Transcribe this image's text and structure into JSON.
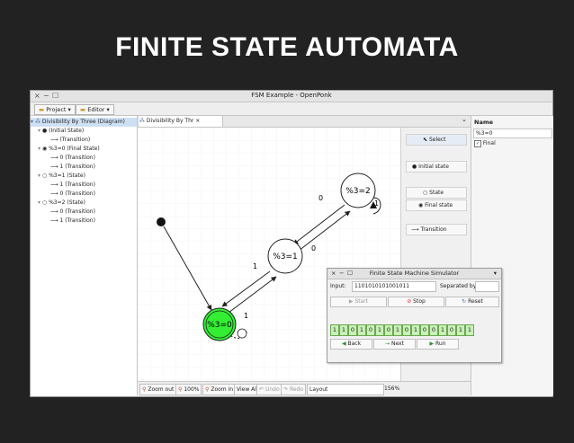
{
  "heading": "FINITE STATE AUTOMATA",
  "window": {
    "title": "FSM Example - OpenPonk",
    "controls": [
      "×",
      "−",
      "☐"
    ]
  },
  "menubar": {
    "project": "Project ▾",
    "editor": "Editor ▾"
  },
  "tree": {
    "items": [
      {
        "label": "Divisibility By Three (Diagram)"
      },
      {
        "label": "(Initial State)"
      },
      {
        "label": "(Transition)"
      },
      {
        "label": "%3=0 (Final State)"
      },
      {
        "label": "0 (Transition)"
      },
      {
        "label": "1 (Transition)"
      },
      {
        "label": "%3=1 (State)"
      },
      {
        "label": "1 (Transition)"
      },
      {
        "label": "0 (Transition)"
      },
      {
        "label": "%3=2 (State)"
      },
      {
        "label": "0 (Transition)"
      },
      {
        "label": "1 (Transition)"
      }
    ]
  },
  "canvas_tab": {
    "label": "Divisibility By Thr",
    "close": "×",
    "menu": "⌄"
  },
  "diagram": {
    "states": [
      {
        "label": "%3=0"
      },
      {
        "label": "%3=1"
      },
      {
        "label": "%3=2"
      }
    ],
    "transition_labels": [
      "1",
      "1",
      "0",
      "0",
      "1"
    ]
  },
  "palette": {
    "items": [
      "Select",
      "Initial state",
      "State",
      "Final state",
      "Transition"
    ]
  },
  "props": {
    "header": "Name",
    "name_value": "%3=0",
    "final_label": "Final",
    "final_checked": true
  },
  "bottom": {
    "zoom_out": "Zoom out",
    "zoom_100": "100%",
    "zoom_in": "Zoom in",
    "view_all": "View All",
    "undo": "Undo",
    "redo": "Redo",
    "layout": "Layout",
    "zoom_level": "156%"
  },
  "simulator": {
    "title": "Finite State Machine Simulator",
    "input_label": "Input:",
    "input_value": "1101010101001011",
    "separated_label": "Separated by:",
    "separated_value": "",
    "start": "Start",
    "stop": "Stop",
    "reset": "Reset",
    "bits": [
      "1",
      "1",
      "0",
      "1",
      "0",
      "1",
      "0",
      "1",
      "0",
      "1",
      "0",
      "0",
      "1",
      "0",
      "1",
      "1"
    ],
    "back": "Back",
    "next": "Next",
    "run": "Run"
  },
  "colors": {
    "final_state_fill": "#33ee33",
    "bit_fill": "#c8f0b8",
    "page_bg": "#222222"
  }
}
